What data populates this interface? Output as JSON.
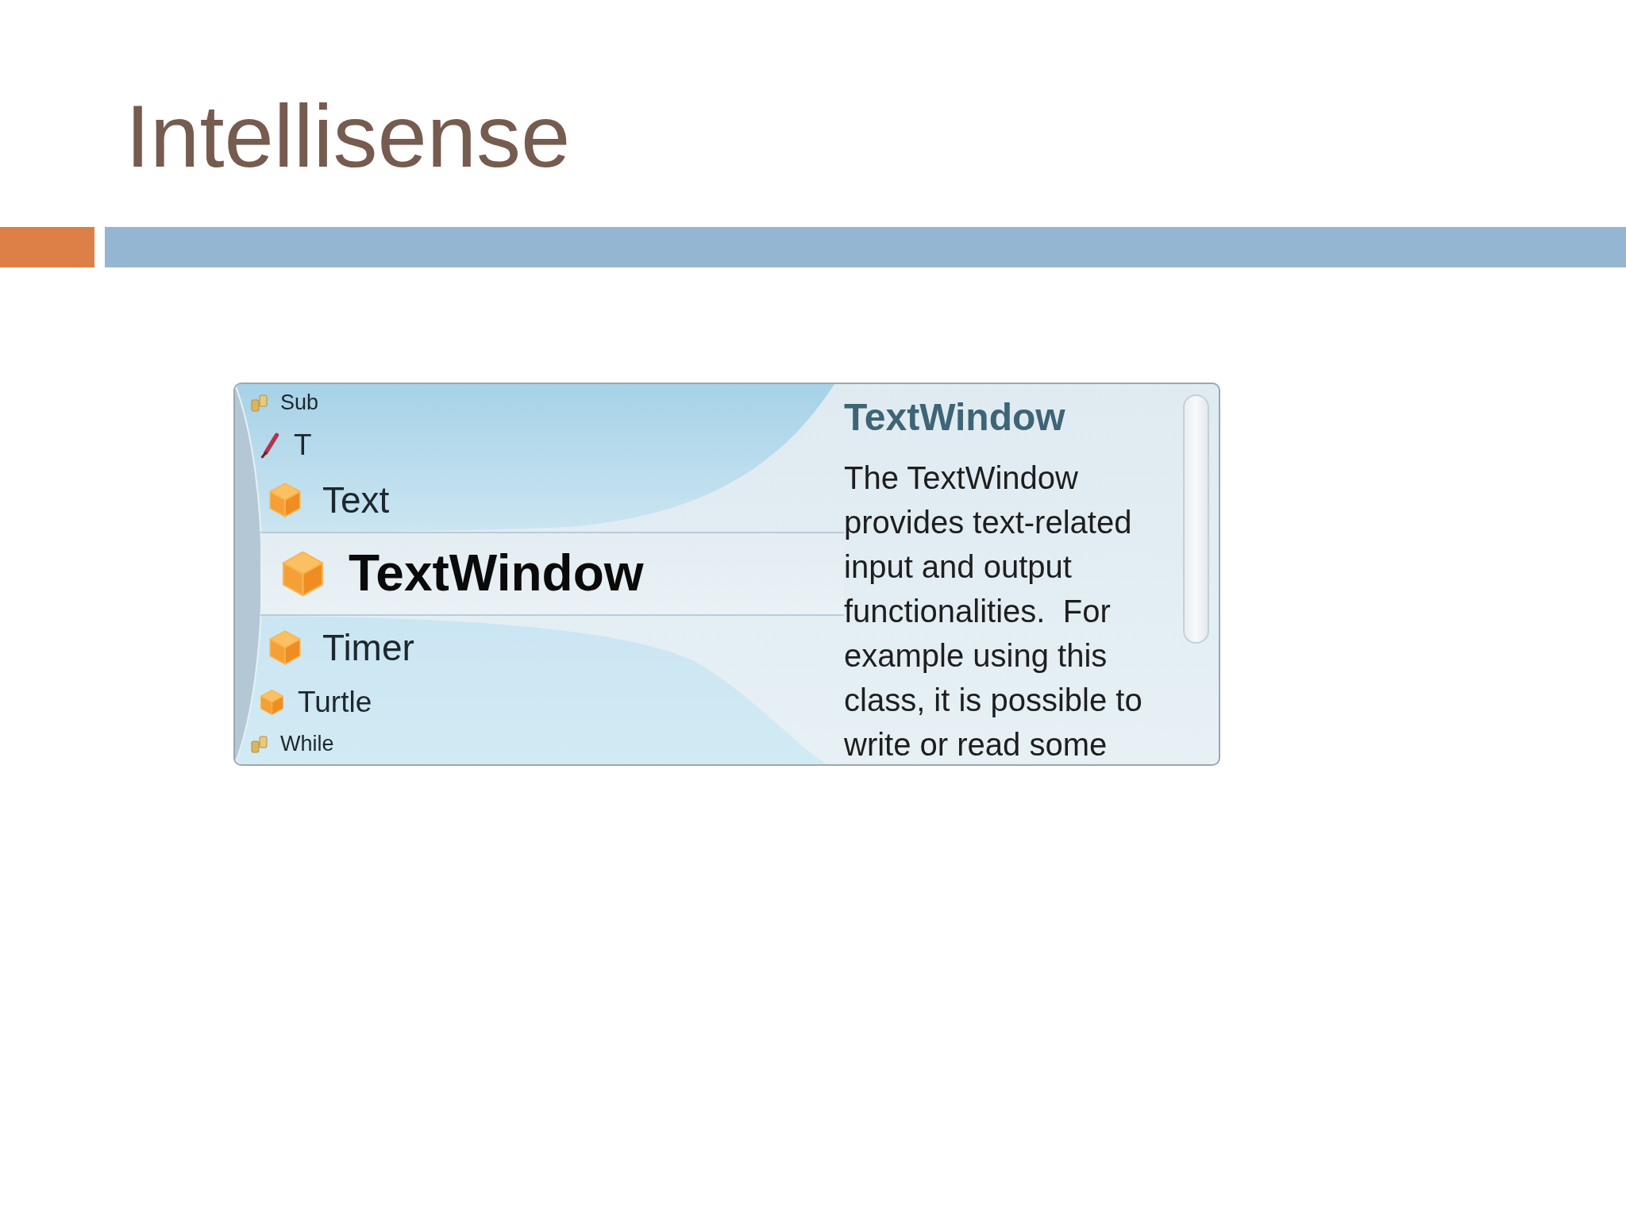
{
  "slide": {
    "title": "Intellisense"
  },
  "autocomplete": {
    "items": [
      {
        "label": "Sub",
        "kind": "keyword",
        "selected": false
      },
      {
        "label": "T",
        "kind": "variable",
        "selected": false
      },
      {
        "label": "Text",
        "kind": "object",
        "selected": false
      },
      {
        "label": "TextWindow",
        "kind": "object",
        "selected": true
      },
      {
        "label": "Timer",
        "kind": "object",
        "selected": false
      },
      {
        "label": "Turtle",
        "kind": "object",
        "selected": false
      },
      {
        "label": "While",
        "kind": "keyword",
        "selected": false
      }
    ],
    "details": {
      "title": "TextWindow",
      "description": "The TextWindow provides text-related input and output functionalities.  For example using this class, it is possible to write or read some"
    }
  }
}
